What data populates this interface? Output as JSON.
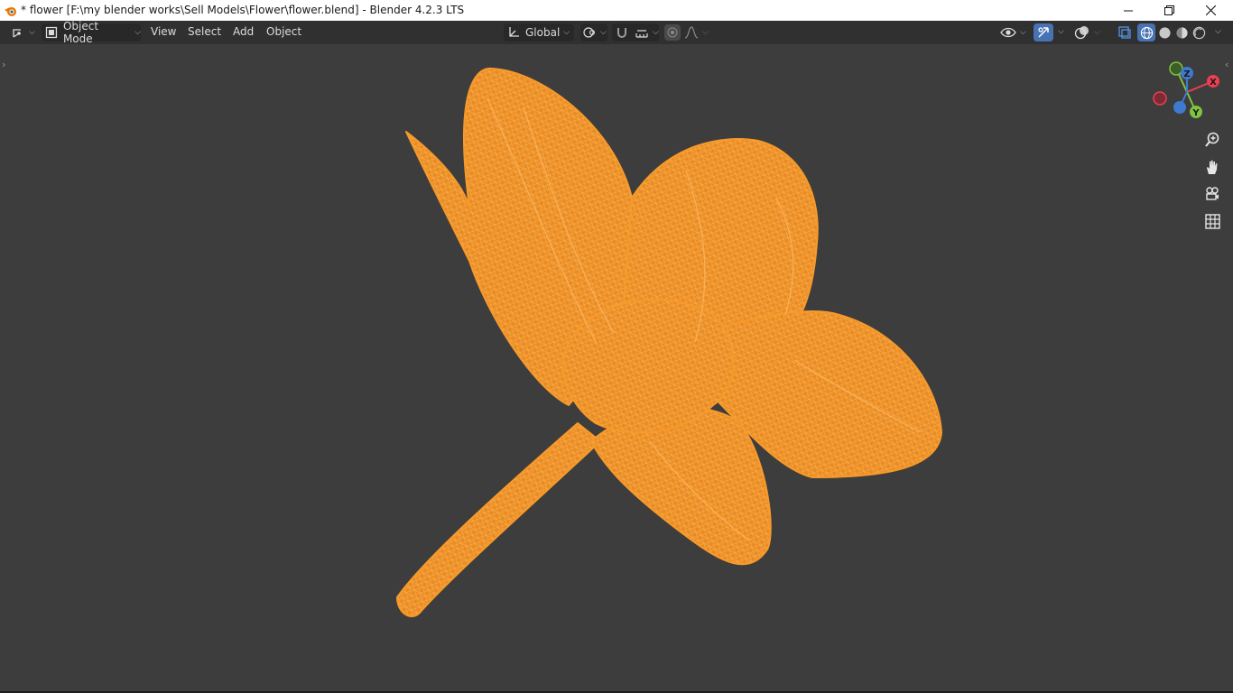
{
  "window": {
    "title": "* flower [F:\\my blender works\\Sell Models\\Flower\\flower.blend] - Blender 4.2.3 LTS",
    "app_icon": "blender-logo-icon",
    "controls": [
      "minimize-icon",
      "restore-icon",
      "close-icon"
    ]
  },
  "header": {
    "editor_type_icon": "3d-viewport-icon",
    "mode": "Object Mode",
    "menus": [
      "View",
      "Select",
      "Add",
      "Object"
    ],
    "transform_orientation": "Global",
    "pivot_icon": "pivot-icon",
    "snap_icon": "magnet-icon",
    "snap_target_icon": "snap-increment-icon",
    "proportional_icon": "proportional-edit-icon",
    "falloff_icon": "falloff-curve-icon",
    "right_icons": [
      "visibility-eye-icon",
      "gizmo-icon",
      "overlay-icon",
      "xray-icon",
      "wireframe-shading-icon",
      "solid-shading-icon",
      "material-preview-icon",
      "rendered-shading-icon"
    ]
  },
  "gizmo": {
    "axes": [
      "X",
      "Y",
      "Z"
    ],
    "colors": {
      "x": "#ed3e52",
      "y": "#7fc341",
      "z": "#3f7ad0"
    }
  },
  "navigation": [
    "zoom-icon",
    "pan-hand-icon",
    "camera-view-icon",
    "ortho-grid-icon"
  ],
  "viewport": {
    "background": "#3d3d3d",
    "object": "flower-wireframe",
    "wire_color": "#f79a2a"
  }
}
